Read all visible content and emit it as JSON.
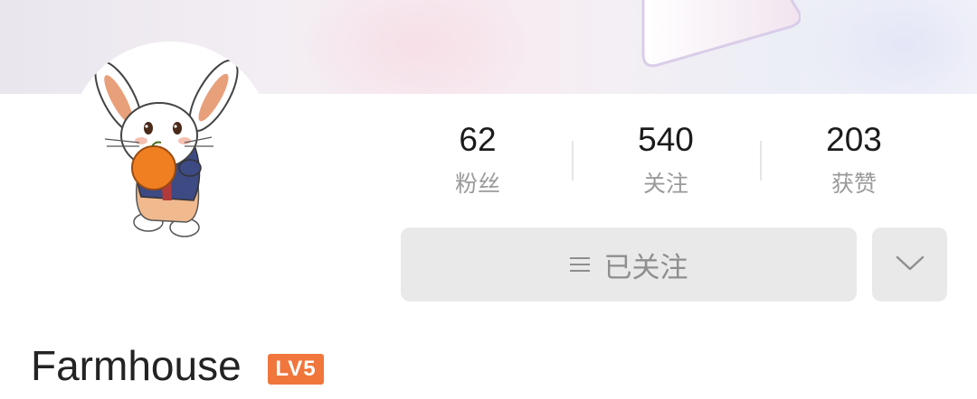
{
  "profile": {
    "username": "Farmhouse",
    "level_badge": "LV5",
    "accent_color": "#f0763c"
  },
  "stats": [
    {
      "value": "62",
      "label": "粉丝"
    },
    {
      "value": "540",
      "label": "关注"
    },
    {
      "value": "203",
      "label": "获赞"
    }
  ],
  "actions": {
    "follow_label": "已关注",
    "menu_icon": "menu-lines-icon",
    "more_icon": "chevron-down-icon"
  }
}
